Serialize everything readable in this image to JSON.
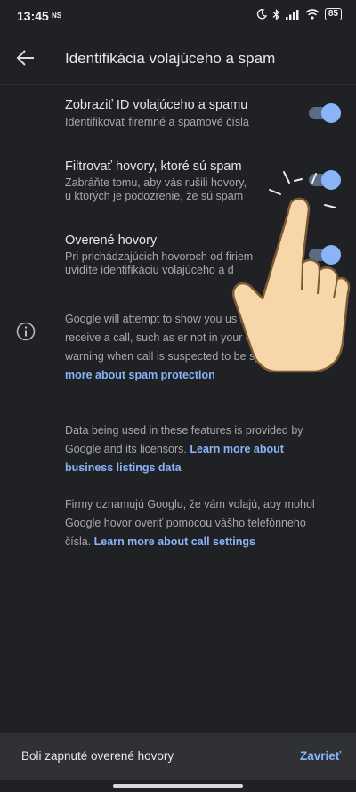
{
  "status_bar": {
    "time": "13:45",
    "carrier": "NS",
    "battery": "85"
  },
  "app_bar": {
    "title": "Identifikácia volajúceho a spam"
  },
  "settings": [
    {
      "title": "Zobraziť ID volajúceho a spamu",
      "subtitle": "Identifikovať firemné a spamové čísla",
      "enabled": true
    },
    {
      "title": "Filtrovať hovory, ktoré sú spam",
      "subtitle": "Zabráňte tomu, aby vás rušili hovory, u ktorých je podozrenie, že sú spam",
      "enabled": true
    },
    {
      "title": "Overené hovory",
      "subtitle": "Pri prichádzajúcich hovoroch od firiem uvidíte identifikáciu volajúceho a d",
      "enabled": true
    }
  ],
  "info": {
    "p1_text": "Google will attempt to show you us                  h you make or receive a call, such as              er not in your contacts or a warning when            call is suspected to be spam.",
    "p1_link": "Learn more about spam protection",
    "p2_text": "Data being used in these features is provided by Google and its licensors.",
    "p2_link": "Learn more about business listings data",
    "p3_text": "Firmy oznamujú Googlu, že vám volajú, aby mohol Google hovor overiť pomocou vášho telefónneho čísla.",
    "p3_link": "Learn more about call settings"
  },
  "snackbar": {
    "message": "Boli zapnuté overené hovory",
    "action": "Zavrieť"
  },
  "colors": {
    "background": "#1f2125",
    "accent": "#8ab4f8",
    "track": "#5b6a86",
    "snackbar": "#2f3135"
  }
}
